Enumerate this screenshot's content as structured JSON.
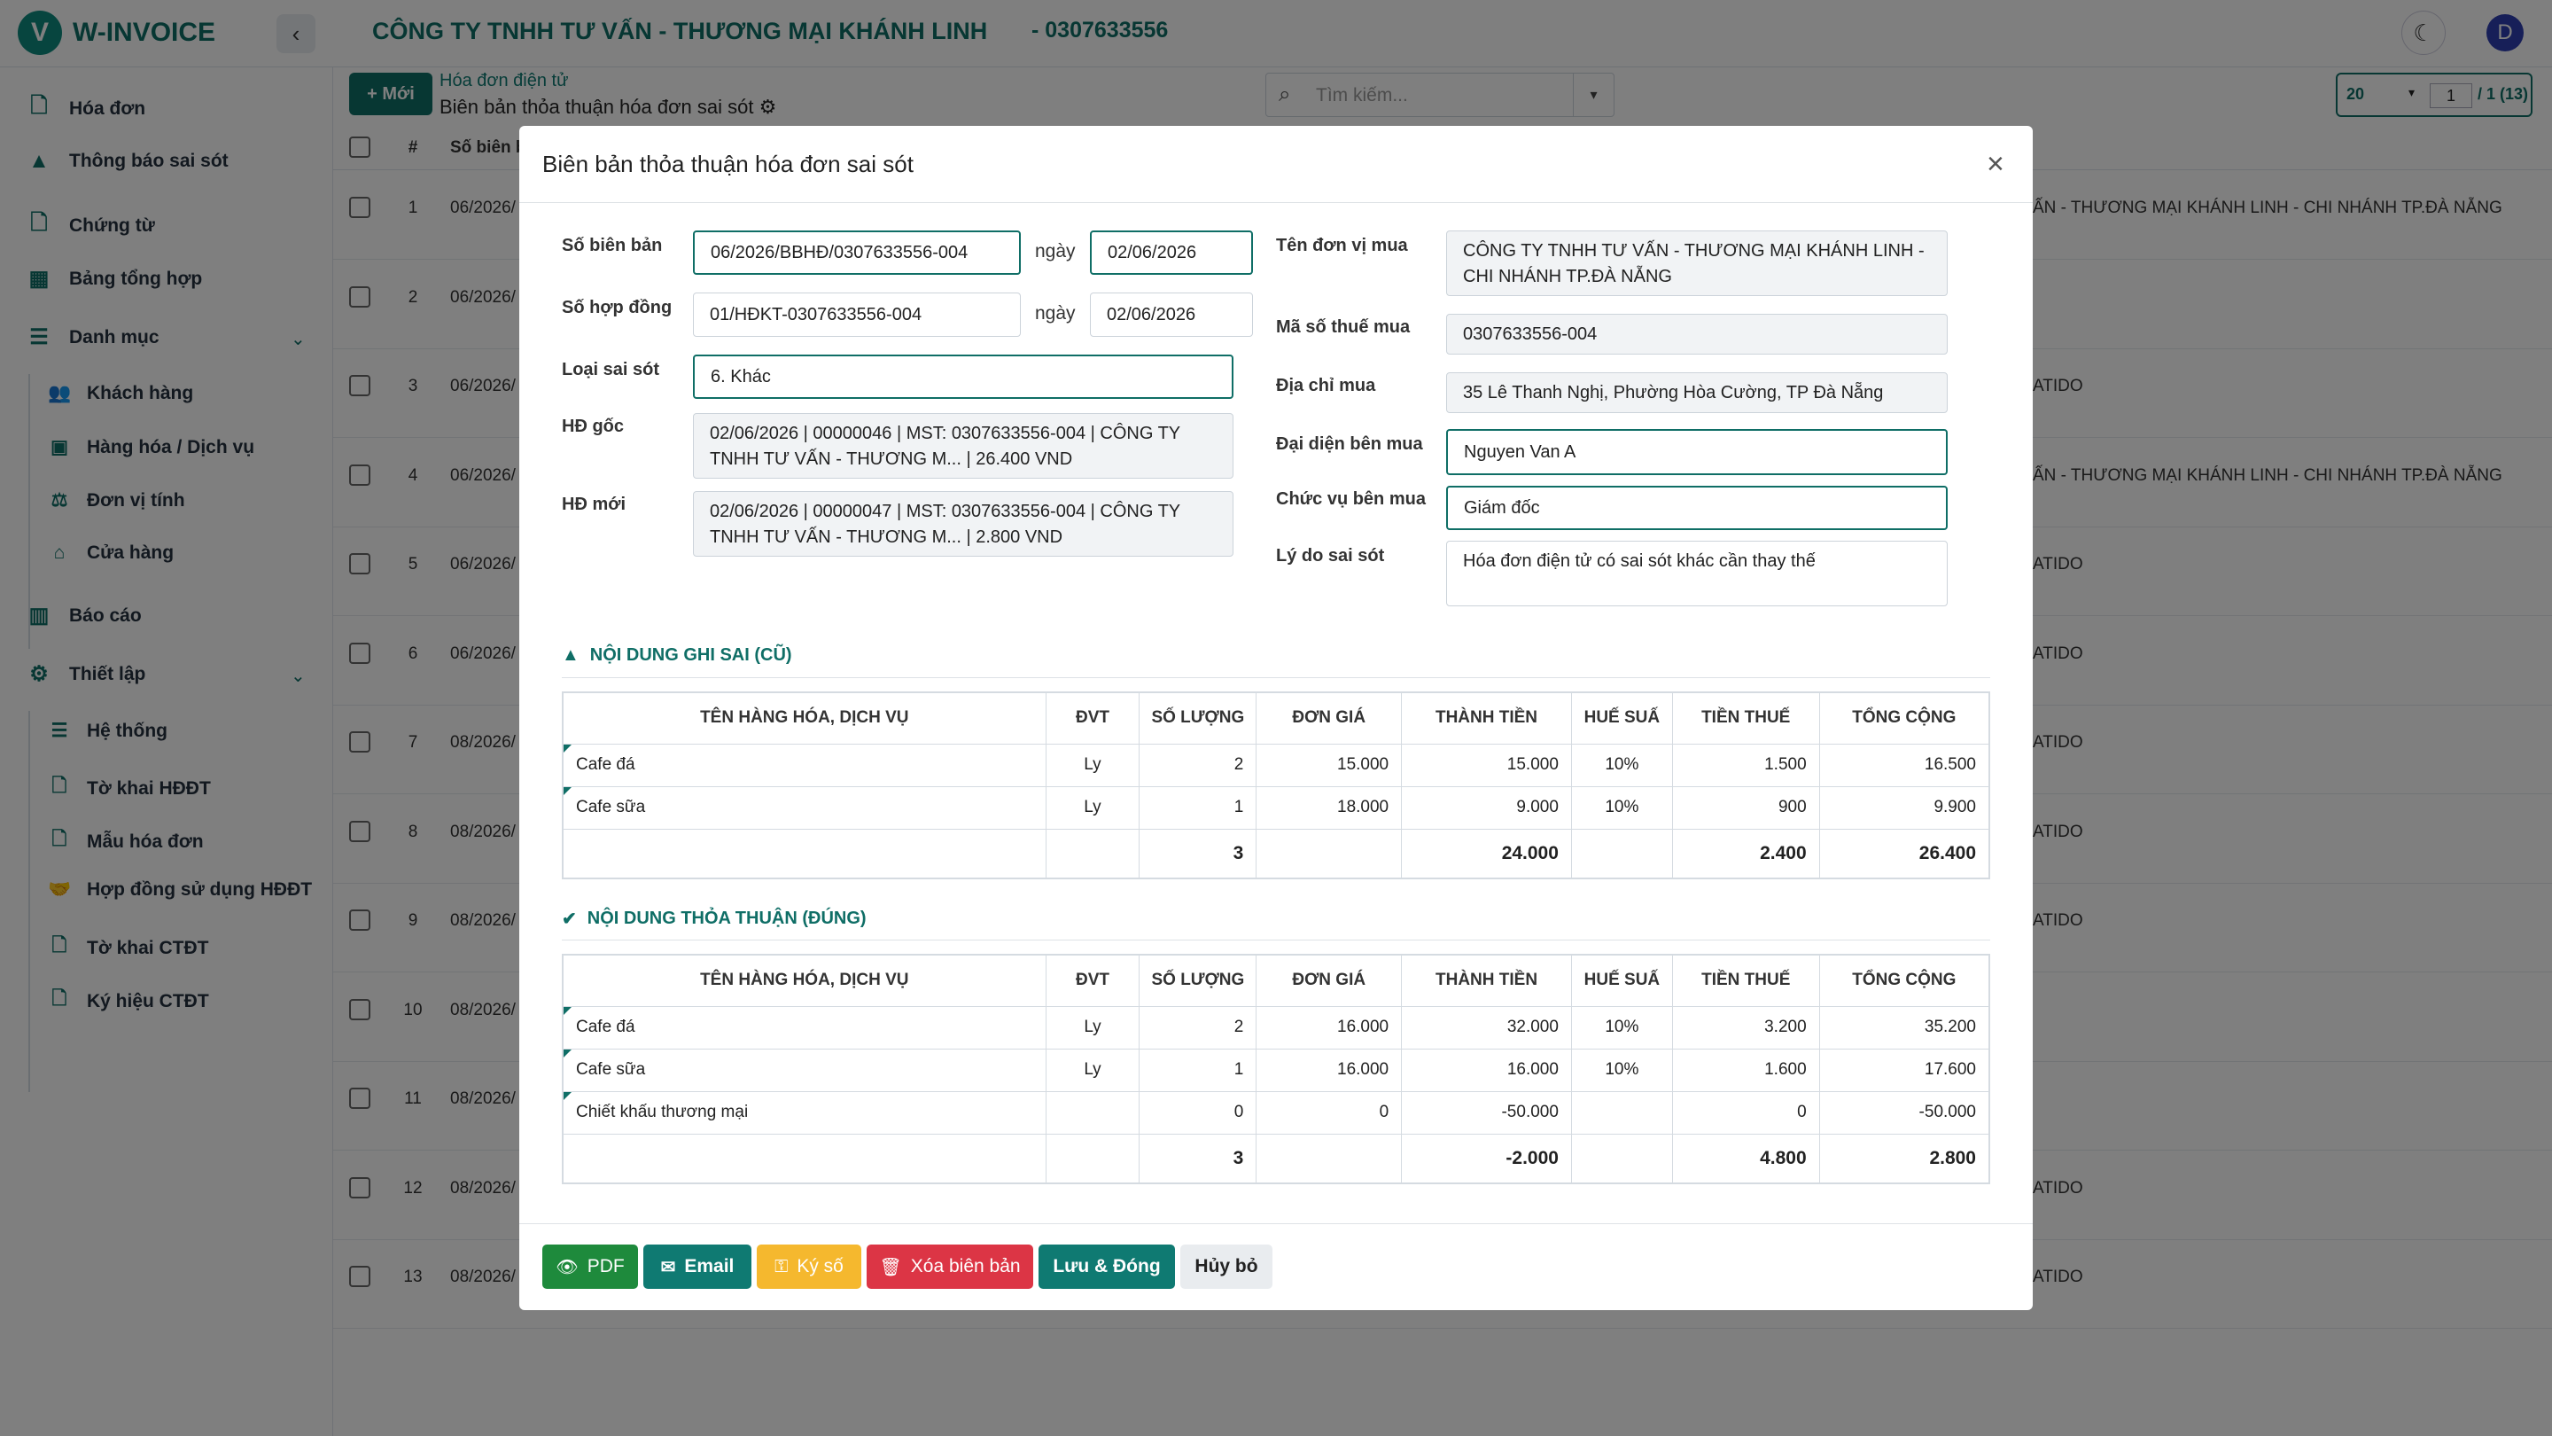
{
  "app": {
    "name": "W-INVOICE",
    "logo_letter": "V",
    "company": "CÔNG TY TNHH TƯ VẤN - THƯƠNG MẠI KHÁNH LINH",
    "tax_code": "- 0307633556",
    "user_initial": "D"
  },
  "sidebar": {
    "items": [
      {
        "label": "Hóa đơn",
        "icon": "document-icon"
      },
      {
        "label": "Thông báo sai sót",
        "icon": "warning-icon"
      },
      {
        "label": "Chứng từ",
        "icon": "file-icon"
      },
      {
        "label": "Bảng tổng hợp",
        "icon": "table-icon"
      },
      {
        "label": "Danh mục",
        "icon": "list-icon"
      },
      {
        "label": "Báo cáo",
        "icon": "chart-icon"
      },
      {
        "label": "Thiết lập",
        "icon": "cogs-icon"
      }
    ],
    "danh_muc_sub": [
      "Khách hàng",
      "Hàng hóa / Dịch vụ",
      "Đơn vị tính",
      "Cửa hàng"
    ],
    "thiet_lap_sub": [
      "Hệ thống",
      "Tờ khai HĐĐT",
      "Mẫu hóa đơn",
      "Hợp đồng sử dụng HĐĐT",
      "Tờ khai CTĐT",
      "Ký hiệu CTĐT"
    ]
  },
  "toolbar": {
    "new_label": "+ Mới",
    "breadcrumb_link": "Hóa đơn điện tử",
    "page_title": "Biên bản thỏa thuận hóa đơn sai sót",
    "search_placeholder": "Tìm kiếm...",
    "page_size": "20",
    "page_number": "1",
    "page_total": "/ 1",
    "record_count": "(13)"
  },
  "list": {
    "col_no": "#",
    "col_so": "Số biên b",
    "rows": [
      {
        "n": "1",
        "so": "06/2026/",
        "tail": "ẤN - THƯƠNG MẠI KHÁNH LINH - CHI NHÁNH TP.ĐÀ NẴNG"
      },
      {
        "n": "2",
        "so": "06/2026/",
        "tail": ""
      },
      {
        "n": "3",
        "so": "06/2026/",
        "tail": "ATIDO"
      },
      {
        "n": "4",
        "so": "06/2026/",
        "tail": "ẤN - THƯƠNG MẠI KHÁNH LINH - CHI NHÁNH TP.ĐÀ NẴNG"
      },
      {
        "n": "5",
        "so": "06/2026/",
        "tail": "ATIDO"
      },
      {
        "n": "6",
        "so": "06/2026/",
        "tail": "ATIDO"
      },
      {
        "n": "7",
        "so": "08/2026/",
        "tail": "ATIDO"
      },
      {
        "n": "8",
        "so": "08/2026/",
        "tail": "ATIDO"
      },
      {
        "n": "9",
        "so": "08/2026/",
        "tail": "ATIDO"
      },
      {
        "n": "10",
        "so": "08/2026/",
        "tail": ""
      },
      {
        "n": "11",
        "so": "08/2026/",
        "tail": ""
      },
      {
        "n": "12",
        "so": "08/2026/",
        "tail": "ATIDO"
      },
      {
        "n": "13",
        "so": "08/2026/",
        "tail": "ATIDO"
      }
    ]
  },
  "modal": {
    "title": "Biên bản thỏa thuận hóa đơn sai sót",
    "so_bien_ban_label": "Số biên bản",
    "so_bien_ban": "06/2026/BBHĐ/0307633556-004",
    "ngay_label": "ngày",
    "ngay_bien_ban": "02/06/2026",
    "so_hop_dong_label": "Số hợp đồng",
    "so_hop_dong": "01/HĐKT-0307633556-004",
    "ngay_hop_dong": "02/06/2026",
    "loai_sai_sot_label": "Loại sai sót",
    "loai_sai_sot": "6. Khác",
    "hd_goc_label": "HĐ gốc",
    "hd_goc": "02/06/2026 | 00000046 | MST: 0307633556-004 | CÔNG TY TNHH TƯ VẤN - THƯƠNG M... | 26.400 VND",
    "hd_moi_label": "HĐ mới",
    "hd_moi": "02/06/2026 | 00000047 | MST: 0307633556-004 | CÔNG TY TNHH TƯ VẤN - THƯƠNG M... | 2.800 VND",
    "ten_don_vi_mua_label": "Tên đơn vị mua",
    "ten_don_vi_mua": "CÔNG TY TNHH TƯ VẤN - THƯƠNG MẠI KHÁNH LINH - CHI NHÁNH TP.ĐÀ NẴNG",
    "mst_mua_label": "Mã số thuế mua",
    "mst_mua": "0307633556-004",
    "dia_chi_mua_label": "Địa chỉ mua",
    "dia_chi_mua": "35 Lê Thanh Nghị, Phường Hòa Cường, TP Đà Nẵng",
    "dai_dien_label": "Đại diện bên mua",
    "dai_dien": "Nguyen Van A",
    "chuc_vu_label": "Chức vụ bên mua",
    "chuc_vu": "Giám đốc",
    "ly_do_label": "Lý do sai sót",
    "ly_do": "Hóa đơn điện tử có sai sót khác cần thay thế",
    "section_old": "NỘI DUNG GHI SAI (CŨ)",
    "section_new": "NỘI DUNG THỎA THUẬN (ĐÚNG)",
    "columns": [
      "TÊN HÀNG HÓA, DỊCH VỤ",
      "ĐVT",
      "SỐ LƯỢNG",
      "ĐƠN GIÁ",
      "THÀNH TIỀN",
      "HUẾ SUẤ",
      "TIỀN THUẾ",
      "TỔNG CỘNG"
    ],
    "old_rows": [
      [
        "Cafe đá",
        "Ly",
        "2",
        "15.000",
        "15.000",
        "10%",
        "1.500",
        "16.500"
      ],
      [
        "Cafe sữa",
        "Ly",
        "1",
        "18.000",
        "9.000",
        "10%",
        "900",
        "9.900"
      ]
    ],
    "old_total": [
      "",
      "",
      "3",
      "",
      "24.000",
      "",
      "2.400",
      "26.400"
    ],
    "new_rows": [
      [
        "Cafe đá",
        "Ly",
        "2",
        "16.000",
        "32.000",
        "10%",
        "3.200",
        "35.200"
      ],
      [
        "Cafe sữa",
        "Ly",
        "1",
        "16.000",
        "16.000",
        "10%",
        "1.600",
        "17.600"
      ],
      [
        "Chiết khấu thương mại",
        "",
        "0",
        "0",
        "-50.000",
        "",
        "0",
        "-50.000"
      ]
    ],
    "new_total": [
      "",
      "",
      "3",
      "",
      "-2.000",
      "",
      "4.800",
      "2.800"
    ],
    "buttons": {
      "pdf": "PDF",
      "email": "Email",
      "ky_so": "Ký số",
      "xoa": "Xóa biên bản",
      "luu": "Lưu & Đóng",
      "huy": "Hủy bỏ"
    },
    "colors": {
      "pdf": "#1e8a3c",
      "email": "#0f7a72",
      "ky_so": "#f5b82e",
      "xoa": "#dc3545",
      "luu": "#0f7a72",
      "huy": "#e9ecef"
    }
  }
}
